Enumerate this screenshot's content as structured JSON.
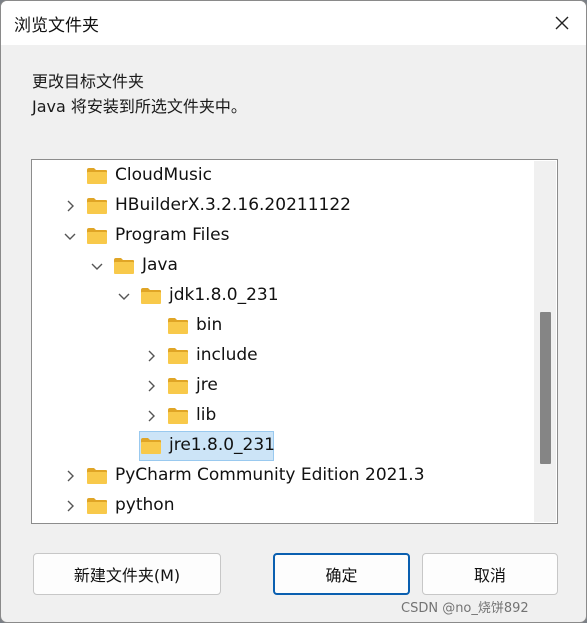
{
  "window": {
    "title": "浏览文件夹",
    "close_icon": "close-icon"
  },
  "prompt": {
    "line1": "更改目标文件夹",
    "line2": "Java 将安装到所选文件夹中。"
  },
  "tree": {
    "items": [
      {
        "label": "CloudMusic",
        "level": 1,
        "expander": "none"
      },
      {
        "label": "HBuilderX.3.2.16.20211122",
        "level": 1,
        "expander": "collapsed"
      },
      {
        "label": "Program Files",
        "level": 1,
        "expander": "expanded"
      },
      {
        "label": "Java",
        "level": 2,
        "expander": "expanded"
      },
      {
        "label": "jdk1.8.0_231",
        "level": 3,
        "expander": "expanded"
      },
      {
        "label": "bin",
        "level": 4,
        "expander": "none"
      },
      {
        "label": "include",
        "level": 4,
        "expander": "collapsed"
      },
      {
        "label": "jre",
        "level": 4,
        "expander": "collapsed"
      },
      {
        "label": "lib",
        "level": 4,
        "expander": "collapsed"
      },
      {
        "label": "jre1.8.0_231",
        "level": 3,
        "expander": "none",
        "selected": true
      },
      {
        "label": "PyCharm Community Edition 2021.3",
        "level": 1,
        "expander": "collapsed"
      },
      {
        "label": "python",
        "level": 1,
        "expander": "collapsed"
      }
    ],
    "selected_color": "#cce4f7",
    "folder_color": "#f8c94a"
  },
  "buttons": {
    "new_folder": "新建文件夹(M)",
    "ok": "确定",
    "cancel": "取消"
  },
  "watermark": "CSDN @no_烧饼892"
}
